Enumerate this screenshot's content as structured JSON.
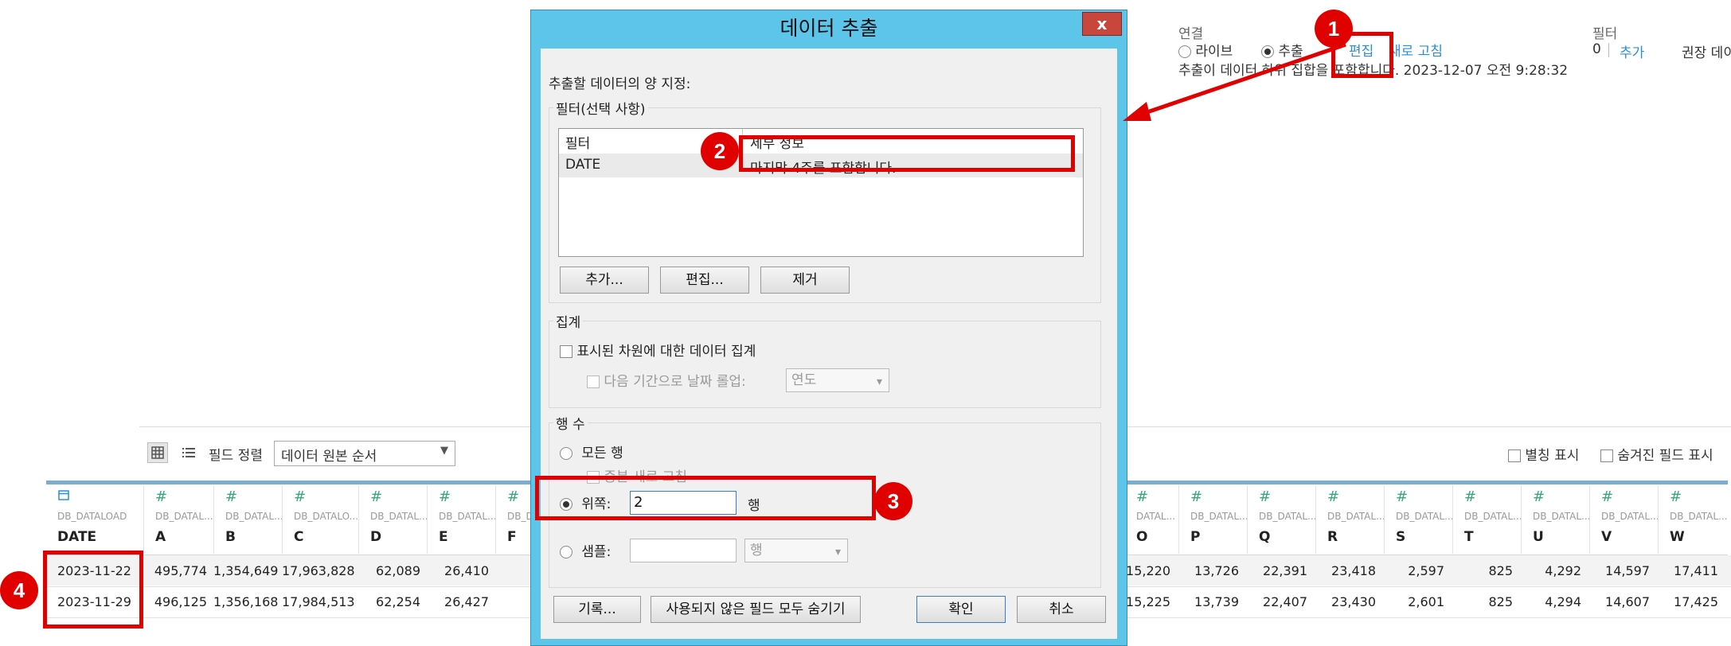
{
  "connection": {
    "title": "연결",
    "live": "라이브",
    "extract": "추출",
    "edit": "편집",
    "refresh": "새로 고침",
    "status": "추출이 데이터 하위 집합을 포함합니다. 2023-12-07 오전 9:28:32"
  },
  "filters_panel": {
    "title": "필터",
    "count": "0",
    "add": "추가",
    "extra": "권장 데이"
  },
  "toolbar": {
    "sort_label": "필드 정렬",
    "sort_value": "데이터 원본 순서",
    "show_alias": "별칭 표시",
    "show_hidden": "숨겨진 필드 표시"
  },
  "grid": {
    "columns_left": [
      {
        "type": "date-icon",
        "src": "DB_DATALOAD",
        "name": "DATE"
      },
      {
        "type": "#",
        "src": "DB_DATAL...",
        "name": "A"
      },
      {
        "type": "#",
        "src": "DB_DATAL...",
        "name": "B"
      },
      {
        "type": "#",
        "src": "DB_DATALO...",
        "name": "C"
      },
      {
        "type": "#",
        "src": "DB_DATAL...",
        "name": "D"
      },
      {
        "type": "#",
        "src": "DB_DATAL...",
        "name": "E"
      },
      {
        "type": "#",
        "src": "DB_DATAL...",
        "name": "F"
      }
    ],
    "columns_right": [
      {
        "type": "#",
        "src": "DATAL...",
        "name": "O"
      },
      {
        "type": "#",
        "src": "DB_DATAL...",
        "name": "P"
      },
      {
        "type": "#",
        "src": "DB_DATAL...",
        "name": "Q"
      },
      {
        "type": "#",
        "src": "DB_DATAL...",
        "name": "R"
      },
      {
        "type": "#",
        "src": "DB_DATAL...",
        "name": "S"
      },
      {
        "type": "#",
        "src": "DB_DATAL...",
        "name": "T"
      },
      {
        "type": "#",
        "src": "DB_DATAL...",
        "name": "U"
      },
      {
        "type": "#",
        "src": "DB_DATAL...",
        "name": "V"
      },
      {
        "type": "#",
        "src": "DB_DATAL...",
        "name": "W"
      }
    ],
    "rows": [
      {
        "left": [
          "2023-11-22",
          "495,774",
          "1,354,649",
          "17,963,828",
          "62,089",
          "26,410"
        ],
        "right": [
          "15,220",
          "13,726",
          "22,391",
          "23,418",
          "2,597",
          "825",
          "4,292",
          "14,597",
          "17,411"
        ]
      },
      {
        "left": [
          "2023-11-29",
          "496,125",
          "1,356,168",
          "17,984,513",
          "62,254",
          "26,427"
        ],
        "right": [
          "15,225",
          "13,739",
          "22,407",
          "23,430",
          "2,601",
          "825",
          "4,294",
          "14,607",
          "17,425"
        ]
      }
    ]
  },
  "dialog": {
    "title": "데이터 추출",
    "close": "x",
    "instruction": "추출할 데이터의 양 지정:",
    "filter_group": "필터(선택 사항)",
    "filter_table": {
      "headers": [
        "필터",
        "세부 정보"
      ],
      "rows": [
        [
          "DATE",
          "마지막 4주를 포함합니다."
        ]
      ]
    },
    "btn_add": "추가...",
    "btn_edit": "편집...",
    "btn_remove": "제거",
    "aggregation_group": "집계",
    "aggregate_visible": "표시된 차원에 대한 데이터 집계",
    "rollup_dates": "다음 기간으로 날짜 롤업:",
    "rollup_value": "연도",
    "rows_group": "행 수",
    "all_rows": "모든 행",
    "incremental": "증분 새로 고침",
    "top": "위쪽:",
    "top_value": "2",
    "rows_unit": "행",
    "sample": "샘플:",
    "sample_unit": "행",
    "btn_history": "기록...",
    "btn_hide_unused": "사용되지 않은 필드 모두 숨기기",
    "btn_ok": "확인",
    "btn_cancel": "취소"
  },
  "annotations": [
    "1",
    "2",
    "3",
    "4"
  ],
  "colors": {
    "accent_red": "#e00000",
    "dialog_frame": "#5ec5ea",
    "link": "#2b8fd6"
  }
}
